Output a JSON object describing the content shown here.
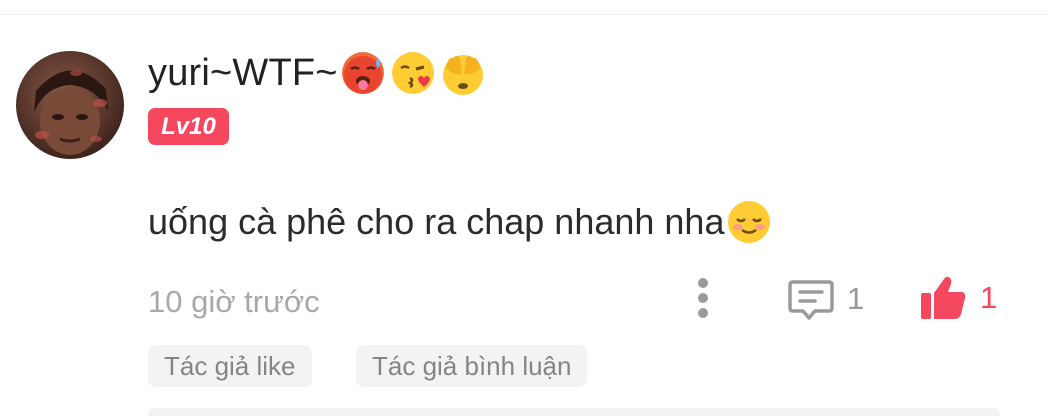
{
  "user": {
    "name": "yuri~WTF~",
    "name_emojis": [
      "hot-face-emoji",
      "face-blowing-kiss-emoji",
      "face-covering-eyes-emoji"
    ],
    "level_badge": "Lv10",
    "avatar_icon": "user-avatar"
  },
  "comment": {
    "text": "uống cà phê cho ra chap nhanh nha",
    "trailing_emoji": "smiling-face-emoji",
    "timestamp": "10 giờ trước"
  },
  "actions": {
    "more_icon": "more-vertical-icon",
    "reply_icon": "comment-icon",
    "reply_count": "1",
    "like_icon": "thumbs-up-icon",
    "like_count": "1"
  },
  "tags": [
    {
      "label": "Tác giả like"
    },
    {
      "label": "Tác giả bình luận"
    }
  ],
  "colors": {
    "accent": "#f5485f",
    "muted_text": "#a8a8a8",
    "tag_background": "#f3f3f3"
  }
}
